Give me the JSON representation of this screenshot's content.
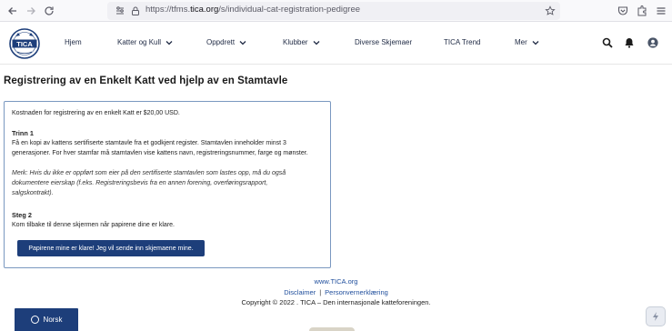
{
  "browser": {
    "url_prefix": "https://tfms.",
    "url_host": "tica.org",
    "url_path": "/s/individual-cat-registration-pedigree"
  },
  "header": {
    "logo_text": "TICA",
    "nav": [
      {
        "label": "Hjem",
        "has_dropdown": false
      },
      {
        "label": "Katter og Kull",
        "has_dropdown": true
      },
      {
        "label": "Oppdrett",
        "has_dropdown": true
      },
      {
        "label": "Klubber",
        "has_dropdown": true
      },
      {
        "label": "Diverse Skjemaer",
        "has_dropdown": false
      },
      {
        "label": "TICA Trend",
        "has_dropdown": false
      },
      {
        "label": "Mer",
        "has_dropdown": true
      }
    ],
    "icons": [
      "search-icon",
      "bell-icon",
      "user-icon"
    ]
  },
  "main": {
    "title": "Registrering av en Enkelt Katt ved hjelp av en Stamtavle",
    "cost_text": "Kostnaden for registrering av en enkelt Katt er $20,00 USD.",
    "step1_heading": "Trinn 1",
    "step1_text_line1": "Få en kopi av kattens sertifiserte stamtavle fra et godkjent register. Stamtavlen inneholder minst 3",
    "step1_text_line2": "generasjoner. For hver stamfar må stamtavlen vise kattens navn, registreringsnummer, farge og mønster.",
    "note_line1": "Merk: Hvis du ikke er oppført som eier på den sertifiserte stamtavlen som lastes opp, må du også",
    "note_line2": "dokumentere eierskap (f.eks. Registreringsbevis fra en annen forening, overføringsrapport,",
    "note_line3": "salgskontrakt).",
    "step2_heading": "Steg 2",
    "step2_text": "Kom tilbake til denne skjermen når papirene dine er klare.",
    "ready_button": "Papirene mine er klare! Jeg vil sende inn skjemaene mine."
  },
  "footer": {
    "site_link": "www.TICA.org",
    "disclaimer": "Disclaimer",
    "separator": "|",
    "privacy": "Personvernerklæring",
    "copyright": "Copyright © 2022 . TICA – Den internasjonale katteforeningen."
  },
  "language_button": "Norsk",
  "colors": {
    "brand_blue": "#1d3e7a",
    "link_blue": "#1f4e9c",
    "card_border": "#7a98c0"
  }
}
